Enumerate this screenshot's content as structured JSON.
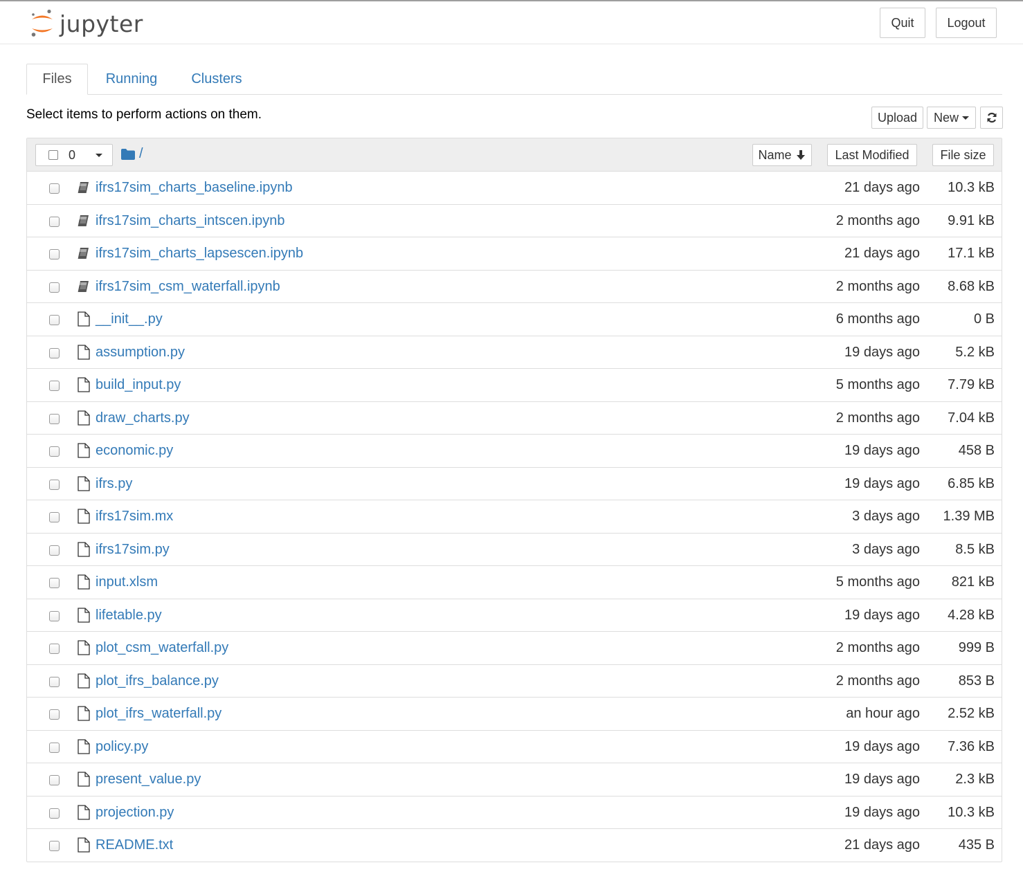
{
  "header": {
    "logo_text": "jupyter",
    "quit_label": "Quit",
    "logout_label": "Logout"
  },
  "tabs": [
    {
      "label": "Files",
      "active": true
    },
    {
      "label": "Running",
      "active": false
    },
    {
      "label": "Clusters",
      "active": false
    }
  ],
  "toolbar": {
    "instructions": "Select items to perform actions on them.",
    "upload_label": "Upload",
    "new_label": "New",
    "refresh_icon": "refresh-icon"
  },
  "list_header": {
    "selected_count": "0",
    "breadcrumb": "/",
    "sort_name_label": "Name",
    "last_modified_label": "Last Modified",
    "file_size_label": "File size"
  },
  "files": [
    {
      "name": "ifrs17sim_charts_baseline.ipynb",
      "type": "notebook",
      "modified": "21 days ago",
      "size": "10.3 kB"
    },
    {
      "name": "ifrs17sim_charts_intscen.ipynb",
      "type": "notebook",
      "modified": "2 months ago",
      "size": "9.91 kB"
    },
    {
      "name": "ifrs17sim_charts_lapsescen.ipynb",
      "type": "notebook",
      "modified": "21 days ago",
      "size": "17.1 kB"
    },
    {
      "name": "ifrs17sim_csm_waterfall.ipynb",
      "type": "notebook",
      "modified": "2 months ago",
      "size": "8.68 kB"
    },
    {
      "name": "__init__.py",
      "type": "file",
      "modified": "6 months ago",
      "size": "0 B"
    },
    {
      "name": "assumption.py",
      "type": "file",
      "modified": "19 days ago",
      "size": "5.2 kB"
    },
    {
      "name": "build_input.py",
      "type": "file",
      "modified": "5 months ago",
      "size": "7.79 kB"
    },
    {
      "name": "draw_charts.py",
      "type": "file",
      "modified": "2 months ago",
      "size": "7.04 kB"
    },
    {
      "name": "economic.py",
      "type": "file",
      "modified": "19 days ago",
      "size": "458 B"
    },
    {
      "name": "ifrs.py",
      "type": "file",
      "modified": "19 days ago",
      "size": "6.85 kB"
    },
    {
      "name": "ifrs17sim.mx",
      "type": "file",
      "modified": "3 days ago",
      "size": "1.39 MB"
    },
    {
      "name": "ifrs17sim.py",
      "type": "file",
      "modified": "3 days ago",
      "size": "8.5 kB"
    },
    {
      "name": "input.xlsm",
      "type": "file",
      "modified": "5 months ago",
      "size": "821 kB"
    },
    {
      "name": "lifetable.py",
      "type": "file",
      "modified": "19 days ago",
      "size": "4.28 kB"
    },
    {
      "name": "plot_csm_waterfall.py",
      "type": "file",
      "modified": "2 months ago",
      "size": "999 B"
    },
    {
      "name": "plot_ifrs_balance.py",
      "type": "file",
      "modified": "2 months ago",
      "size": "853 B"
    },
    {
      "name": "plot_ifrs_waterfall.py",
      "type": "file",
      "modified": "an hour ago",
      "size": "2.52 kB"
    },
    {
      "name": "policy.py",
      "type": "file",
      "modified": "19 days ago",
      "size": "7.36 kB"
    },
    {
      "name": "present_value.py",
      "type": "file",
      "modified": "19 days ago",
      "size": "2.3 kB"
    },
    {
      "name": "projection.py",
      "type": "file",
      "modified": "19 days ago",
      "size": "10.3 kB"
    },
    {
      "name": "README.txt",
      "type": "file",
      "modified": "21 days ago",
      "size": "435 B"
    }
  ],
  "colors": {
    "link": "#337ab7",
    "logo_orange": "#f37726",
    "logo_gray": "#767677",
    "header_bg": "#eeeeee",
    "border": "#dddddd"
  }
}
